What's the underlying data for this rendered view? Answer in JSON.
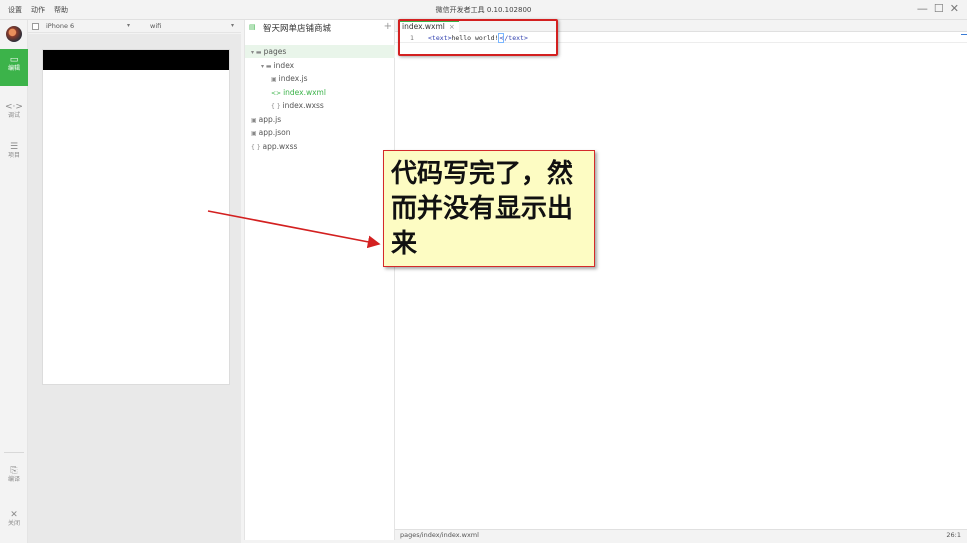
{
  "menu": [
    "设置",
    "动作",
    "帮助"
  ],
  "app_title": "微信开发者工具 0.10.102800",
  "window_controls": {
    "minimize": "—",
    "maximize": "☐",
    "close": "✕"
  },
  "sidebar": [
    {
      "icon": "edit-icon",
      "glyph": "▭",
      "label": "编辑",
      "active": true
    },
    {
      "icon": "code-icon",
      "glyph": "<·>",
      "label": "调试",
      "active": false
    },
    {
      "icon": "project-icon",
      "glyph": "☰",
      "label": "项目",
      "active": false
    },
    {
      "icon": "compile-icon",
      "glyph": "⎘",
      "label": "编译",
      "active": false
    },
    {
      "icon": "close-icon",
      "glyph": "✕",
      "label": "关闭",
      "active": false
    }
  ],
  "simulator": {
    "device": "iPhone 6",
    "network": "wifi"
  },
  "project": {
    "name": "智天网单店铺商城",
    "add": "+"
  },
  "tree": [
    {
      "label": "pages",
      "type": "folder",
      "depth": 0,
      "open": true
    },
    {
      "label": "index",
      "type": "folder",
      "depth": 1,
      "open": true
    },
    {
      "label": "index.js",
      "type": "js",
      "depth": 2
    },
    {
      "label": "index.wxml",
      "type": "wxml",
      "depth": 2,
      "active": true
    },
    {
      "label": "index.wxss",
      "type": "wxss",
      "depth": 2
    },
    {
      "label": "app.js",
      "type": "js",
      "depth": 0
    },
    {
      "label": "app.json",
      "type": "json",
      "depth": 0
    },
    {
      "label": "app.wxss",
      "type": "wxss",
      "depth": 0
    }
  ],
  "editor": {
    "tab": "index.wxml",
    "tab_close": "×",
    "line_number": "1",
    "code": {
      "open_tag": "<text>",
      "content": "hello world!",
      "close_lt": "<",
      "close_rest": "/text>"
    },
    "status_path": "pages/index/index.wxml",
    "status_pos": "26:1"
  },
  "annotation": {
    "text": "代码写完了，然而并没有显示出来"
  },
  "colors": {
    "accent": "#3cb34a",
    "annotation_red": "#d32020",
    "callout_bg": "#fdfcc3"
  }
}
